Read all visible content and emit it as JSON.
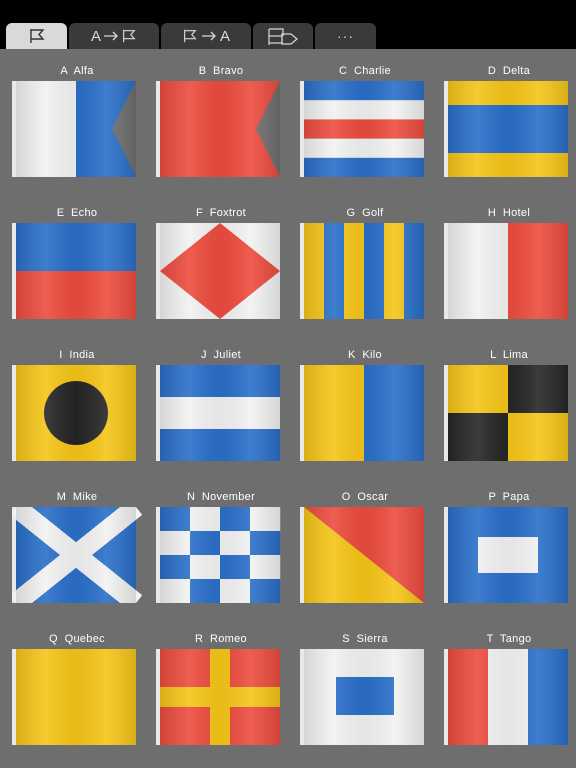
{
  "tabs": [
    {
      "id": "flags",
      "icon": "flag-icon",
      "active": true
    },
    {
      "id": "letter-to-flag",
      "icon": "letter-to-flag-icon",
      "letter": "A",
      "active": false
    },
    {
      "id": "flag-to-letter",
      "icon": "flag-to-letter-icon",
      "letter": "A",
      "active": false
    },
    {
      "id": "signal",
      "icon": "signal-flag-icon",
      "active": false
    },
    {
      "id": "more",
      "icon": "more-icon",
      "label": "···",
      "active": false
    }
  ],
  "colors": {
    "red": "#ec4c3e",
    "blue": "#2a6fc9",
    "yellow": "#f5c518",
    "white": "#f2f2f2",
    "black": "#262626",
    "panel": "#6e6e6e",
    "pole": "#e8e8e8"
  },
  "flags": [
    {
      "letter": "A",
      "name": "Alfa",
      "label": "A  Alfa"
    },
    {
      "letter": "B",
      "name": "Bravo",
      "label": "B  Bravo"
    },
    {
      "letter": "C",
      "name": "Charlie",
      "label": "C  Charlie"
    },
    {
      "letter": "D",
      "name": "Delta",
      "label": "D  Delta"
    },
    {
      "letter": "E",
      "name": "Echo",
      "label": "E  Echo"
    },
    {
      "letter": "F",
      "name": "Foxtrot",
      "label": "F  Foxtrot"
    },
    {
      "letter": "G",
      "name": "Golf",
      "label": "G  Golf"
    },
    {
      "letter": "H",
      "name": "Hotel",
      "label": "H  Hotel"
    },
    {
      "letter": "I",
      "name": "India",
      "label": "I  India"
    },
    {
      "letter": "J",
      "name": "Juliet",
      "label": "J  Juliet"
    },
    {
      "letter": "K",
      "name": "Kilo",
      "label": "K  Kilo"
    },
    {
      "letter": "L",
      "name": "Lima",
      "label": "L  Lima"
    },
    {
      "letter": "M",
      "name": "Mike",
      "label": "M  Mike"
    },
    {
      "letter": "N",
      "name": "November",
      "label": "N  November"
    },
    {
      "letter": "O",
      "name": "Oscar",
      "label": "O  Oscar"
    },
    {
      "letter": "P",
      "name": "Papa",
      "label": "P  Papa"
    },
    {
      "letter": "Q",
      "name": "Quebec",
      "label": "Q  Quebec"
    },
    {
      "letter": "R",
      "name": "Romeo",
      "label": "R  Romeo"
    },
    {
      "letter": "S",
      "name": "Sierra",
      "label": "S  Sierra"
    },
    {
      "letter": "T",
      "name": "Tango",
      "label": "T  Tango"
    }
  ]
}
